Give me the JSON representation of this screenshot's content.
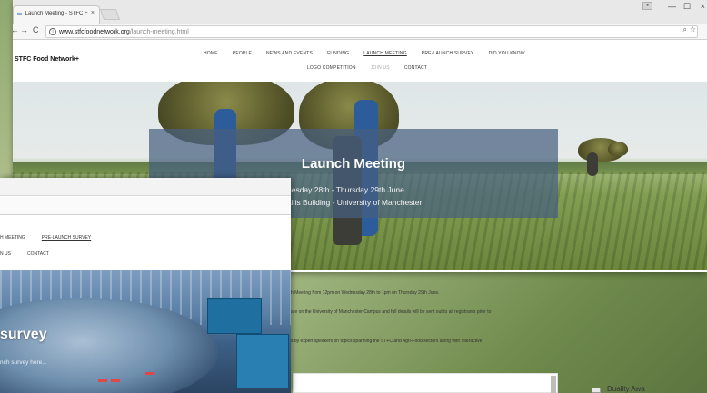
{
  "main_window": {
    "tab": {
      "favicon": "stfc-favicon",
      "title": "Launch Meeting - STFC F",
      "close": "×"
    },
    "window_controls": {
      "profile": "profile-icon",
      "minimize": "—",
      "maximize": "☐",
      "close": "×"
    },
    "address_bar": {
      "back": "←",
      "forward": "→",
      "reload": "C",
      "url_host": "www.stfcfoodnetwork.org",
      "url_path": "/launch-meeting.html",
      "zoom_icon": "search-icon",
      "star_icon": "star-icon"
    },
    "site": {
      "logo": "STFC Food Network+",
      "nav_row1": [
        "HOME",
        "PEOPLE",
        "NEWS AND EVENTS",
        "FUNDING",
        "LAUNCH MEETING",
        "PRE-LAUNCH SURVEY",
        "DID YOU KNOW ..."
      ],
      "nav_row2": [
        "LOGO COMPETITION",
        "JOIN US",
        "CONTACT"
      ],
      "active_nav": "LAUNCH MEETING"
    },
    "hero": {
      "title": "Launch Meeting",
      "line1": "nesday 28th - Thursday 29th June",
      "line2": "allis Building - University of Manchester"
    },
    "content": {
      "p1": "h Meeting from 12pm on Wednesday 28th to 1pm on  Thursday 29th June.",
      "p2": "are on the University of Manchester Campus and full details will be sent out to all registrants prior to",
      "p3": "s by expert speakers on topics spanning the STFC and Agri-Food sectors along with interactive"
    },
    "stray_text": "Duality Awa"
  },
  "front_window": {
    "nav_row1": [
      "H MEETING",
      "PRE-LAUNCH SURVEY"
    ],
    "nav_row2": [
      "N US",
      "CONTACT"
    ],
    "active_nav": "PRE-LAUNCH SURVEY",
    "hero": {
      "title": "survey",
      "subtitle": "nch survey here..."
    }
  }
}
